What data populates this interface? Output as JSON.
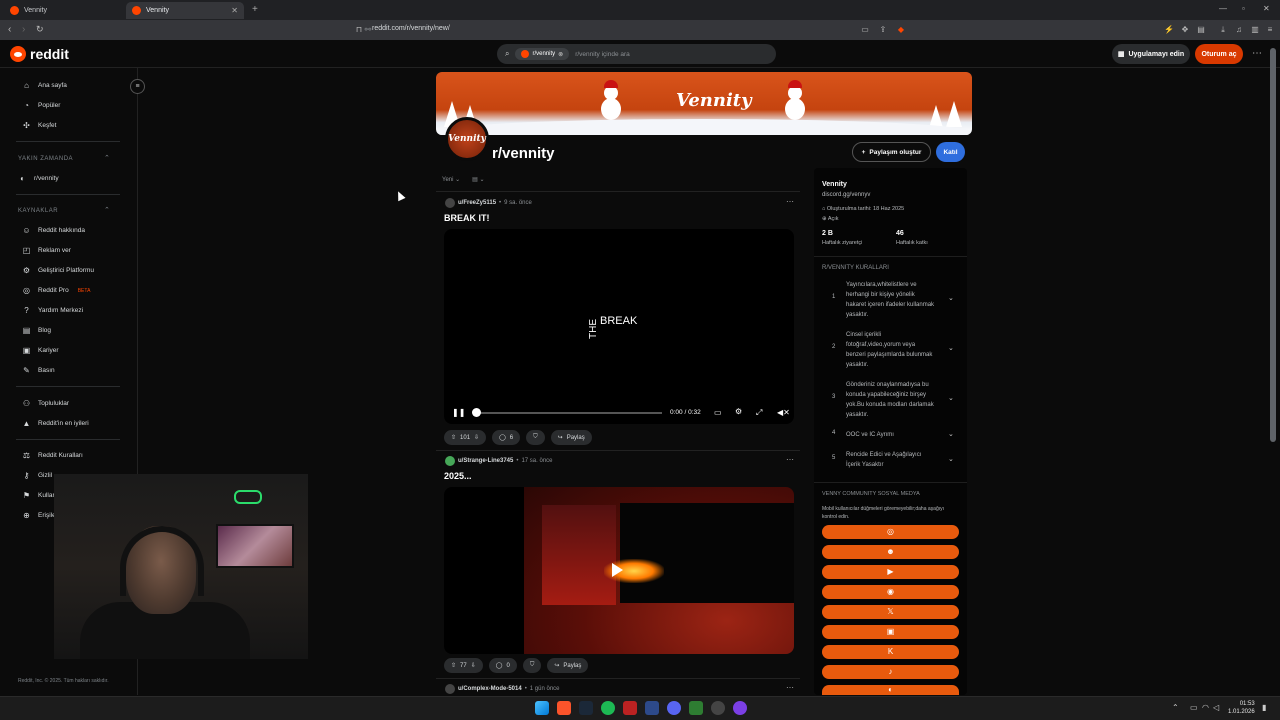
{
  "browser": {
    "tabs": [
      {
        "label": "Vennity",
        "active": false
      },
      {
        "label": "Vennity",
        "active": true
      }
    ],
    "url": "reddit.com/r/vennity/new/"
  },
  "header": {
    "logo": "reddit",
    "search_chip": "r/vennity",
    "search_placeholder": "r/vennity içinde ara",
    "app_button": "Uygulamayı edin",
    "login_button": "Oturum aç"
  },
  "sidebar": {
    "main": [
      {
        "label": "Ana sayfa",
        "icon": "home-icon"
      },
      {
        "label": "Popüler",
        "icon": "popular-icon"
      },
      {
        "label": "Keşfet",
        "icon": "explore-icon"
      }
    ],
    "recent_header": "YAKIN ZAMANDA",
    "recent": [
      {
        "label": "r/vennity"
      }
    ],
    "resources_header": "KAYNAKLAR",
    "resources": [
      {
        "label": "Reddit hakkında"
      },
      {
        "label": "Reklam ver"
      },
      {
        "label": "Geliştirici Platformu"
      },
      {
        "label": "Reddit Pro",
        "badge": "BETA"
      },
      {
        "label": "Yardım Merkezi"
      },
      {
        "label": "Blog"
      },
      {
        "label": "Kariyer"
      },
      {
        "label": "Basın"
      }
    ],
    "community": [
      {
        "label": "Topluluklar"
      },
      {
        "label": "Reddit'in en iyileri"
      }
    ],
    "policies": [
      {
        "label": "Reddit Kuralları"
      },
      {
        "label": "Gizlil"
      },
      {
        "label": "Kullan"
      },
      {
        "label": "Erişile"
      }
    ],
    "copyright": "Reddit, Inc. © 2025. Tüm hakları saklıdır."
  },
  "subreddit": {
    "banner_word": "Vennity",
    "avatar_word": "Vennity",
    "name": "r/vennity",
    "create_post": "Paylaşım oluştur",
    "join": "Katıl",
    "sort": "Yeni"
  },
  "posts": [
    {
      "user": "u/FreeZy5115",
      "time": "9 sa. önce",
      "title": "BREAK IT!",
      "video_text_h": "BREAK",
      "video_text_v": "THE",
      "video_time": "0:00 / 0:32",
      "votes": "101",
      "comments": "6",
      "share": "Paylaş"
    },
    {
      "user": "u/Strange-Line3745",
      "time": "17 sa. önce",
      "title": "2025...",
      "votes": "77",
      "comments": "0",
      "share": "Paylaş"
    },
    {
      "user": "u/Complex-Mode-5014",
      "time": "1 gün önce"
    }
  ],
  "right_panel": {
    "title": "Vennity",
    "link": "discord.gg/vennyv",
    "created": "Oluşturulma tarihi: 18 Haz 2025",
    "visibility": "Açık",
    "stats": [
      {
        "value": "2 B",
        "label": "Haftalık ziyaretçi"
      },
      {
        "value": "46",
        "label": "Haftalık katkı"
      }
    ],
    "rules_header": "R/VENNITY KURALLARI",
    "rules": [
      {
        "num": "1",
        "text": "Yayıncılara,whitelistlere ve herhangi bir kişiye yönelik hakaret içeren ifadeler kullanmak yasaktır."
      },
      {
        "num": "2",
        "text": "Cinsel içerikli fotoğraf,video,yorum veya benzeri paylaşımlarda bulunmak yasaktır."
      },
      {
        "num": "3",
        "text": "Gönderiniz onaylanmadıysa bu konuda yapabileceğiniz birşey yok.Bu konuda modları darlamak yasaktır."
      },
      {
        "num": "4",
        "text": "OOC ve IC Ayrımı"
      },
      {
        "num": "5",
        "text": "Rencide Edici ve Aşağılayıcı İçerik Yasaktır"
      }
    ],
    "social_header": "VENNY COMMUNITY SOSYAL MEDYA",
    "social_desc": "Mobil kullanıcılar düğmeleri göremeyebilir;daha aşağıyı kontrol edin.",
    "social_buttons": [
      "◎",
      "☻",
      "▶",
      "◉",
      "𝕏",
      "▣",
      "K",
      "♪",
      "◐"
    ]
  },
  "taskbar": {
    "time": "01:53",
    "date": "1.01.2026"
  }
}
